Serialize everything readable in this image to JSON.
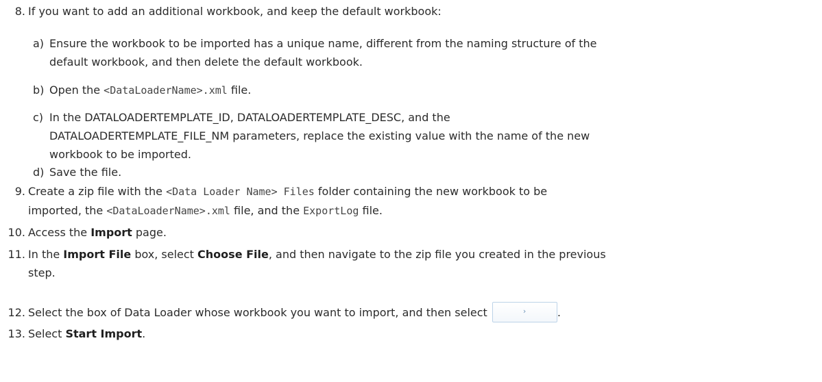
{
  "step8": {
    "num": "8.",
    "text": "If you want to add an additional workbook, and keep the default workbook:",
    "a": {
      "letter": "a)",
      "line1": "Ensure the workbook to be imported has a unique name, different from the naming structure of the",
      "line2": "default workbook, and then delete the default workbook."
    },
    "b": {
      "letter": "b)",
      "pre": "Open the ",
      "code": "<DataLoaderName>.xml",
      "post": " file."
    },
    "c": {
      "letter": "c)",
      "line1": "In the DATALOADERTEMPLATE_ID, DATALOADERTEMPLATE_DESC, and the",
      "line2": "DATALOADERTEMPLATE_FILE_NM parameters, replace the existing value with the name of the new",
      "line3": "workbook to be imported."
    },
    "d": {
      "letter": "d)",
      "text": "Save the file."
    }
  },
  "step9": {
    "num": "9.",
    "pre": "Create a zip file with the ",
    "code1": "<Data Loader Name> Files",
    "mid1": " folder containing the new workbook to be",
    "line2_pre": "imported, the ",
    "code2": "<DataLoaderName>.xml",
    "mid2": " file, and the ",
    "code3": "ExportLog",
    "post": " file."
  },
  "step10": {
    "num": "10.",
    "pre": "Access the ",
    "bold": "Import",
    "post": " page."
  },
  "step11": {
    "num": "11.",
    "pre": "In the ",
    "bold1": "Import File",
    "mid": " box, select ",
    "bold2": "Choose File",
    "post": ", and then navigate to the zip file you created in the previous",
    "line2": "step."
  },
  "step12": {
    "num": "12.",
    "text": "Select the box of Data Loader whose workbook you want to import, and then select ",
    "button_glyph": "›",
    "post": "."
  },
  "step13": {
    "num": "13.",
    "pre": "Select ",
    "bold": "Start Import",
    "post": "."
  }
}
